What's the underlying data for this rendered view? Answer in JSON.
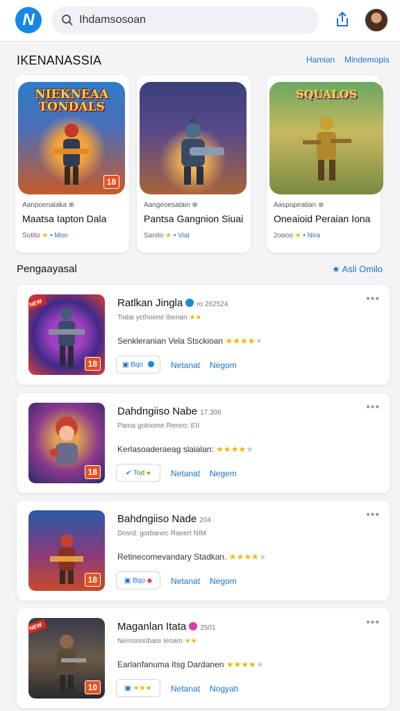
{
  "topbar": {
    "logo_letter": "N",
    "search_value": "Ihdamsosoan",
    "icons": [
      "search-icon",
      "share-icon",
      "avatar"
    ]
  },
  "featured": {
    "title": "IKENANASSIA",
    "links": [
      "Hamian",
      "Mindemopis"
    ],
    "cards": [
      {
        "art_title": "NIEKNEAA TONDALS",
        "badge": "18",
        "dev": "Aanpoenalaka",
        "name": "Maatsa Iapton Dala",
        "meta": "Sotito",
        "tag": "Mon"
      },
      {
        "art_title": "",
        "badge": "",
        "dev": "Aangeoesatain",
        "name": "Pantsa Gangnion Siuai",
        "meta": "Sanito",
        "tag": "Viai"
      },
      {
        "art_title": "SQUALOS",
        "badge": "",
        "dev": "Aaspopeatian",
        "name": "Oneaioid Peraian Iona",
        "meta": "2oooo",
        "tag": "Nira"
      }
    ]
  },
  "list": {
    "title": "Pengaayasal",
    "link": "Asli Omilo",
    "items": [
      {
        "title": "Ratlkan Jingla",
        "sub": "ro 262524",
        "tag": "Todai ycthoone Ibenan",
        "desc": "Senkleranian Vela Stsckioan",
        "btn": "Bqo",
        "link1": "Netanat",
        "link2": "Negom",
        "badge": "18",
        "ribbon": "NEW",
        "badge_icon": "verified-icon"
      },
      {
        "title": "Dahdngiiso Nabe",
        "sub": "17.306",
        "tag": "Pama gotnome Reneo: EII",
        "desc": "Kerlasoaderaeag slaialan:",
        "btn": "Tod",
        "link1": "Netanat",
        "link2": "Negem",
        "badge": "18",
        "ribbon": "",
        "badge_icon": ""
      },
      {
        "title": "Bahdngiiso Nade",
        "sub": "204",
        "tag": "Dosrd: gorbanec Raeert NIM",
        "desc": "Retinecomevandary Stadkan.",
        "btn": "Bqo",
        "link1": "Netanat",
        "link2": "Negom",
        "badge": "18",
        "ribbon": "",
        "badge_icon": ""
      },
      {
        "title": "Maganlan Itata",
        "sub": "2501",
        "tag": "Nemonoribare Ieoam",
        "desc": "Earlanfanuma Itsg Dardanen",
        "btn": "",
        "link1": "Netanat",
        "link2": "Nogyah",
        "badge": "10",
        "ribbon": "NEW",
        "badge_icon": "pink-icon"
      }
    ]
  },
  "colors": {
    "accent": "#1b73c9",
    "brand": "#1687e8",
    "star": "#f5b400",
    "badge": "#e8501e"
  }
}
